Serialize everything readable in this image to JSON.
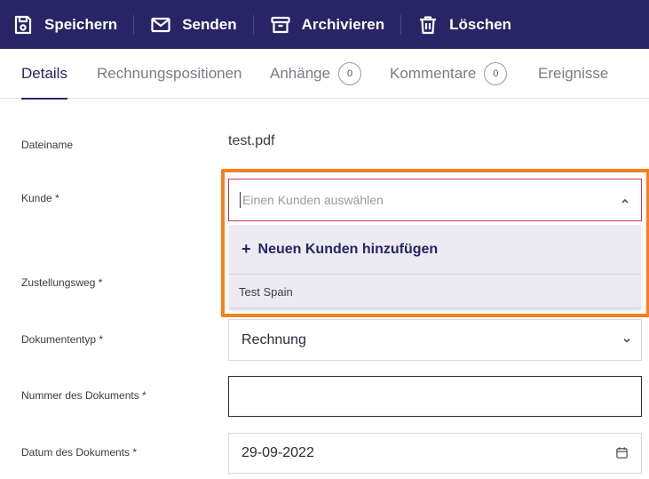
{
  "toolbar": {
    "save_label": "Speichern",
    "send_label": "Senden",
    "archive_label": "Archivieren",
    "delete_label": "Löschen",
    "icons": [
      "save-icon",
      "envelope-icon",
      "archive-icon",
      "trash-icon"
    ]
  },
  "tabs": [
    {
      "label": "Details",
      "active": true
    },
    {
      "label": "Rechnungspositionen"
    },
    {
      "label": "Anhänge",
      "count": "0"
    },
    {
      "label": "Kommentare",
      "count": "0"
    },
    {
      "label": "Ereignisse"
    }
  ],
  "form": {
    "filename_label": "Dateiname",
    "filename_value": "test.pdf",
    "customer_label": "Kunde *",
    "customer_placeholder": "Einen Kunden auswählen",
    "customer_add_label": "Neuen Kunden hinzufügen",
    "customer_options": [
      "Test Spain"
    ],
    "delivery_label": "Zustellungsweg *",
    "doctype_label": "Dokumententyp *",
    "doctype_value": "Rechnung",
    "docnumber_label": "Nummer des Dokuments *",
    "docnumber_value": "",
    "docdate_label": "Datum des Dokuments *",
    "docdate_value": "29-09-2022"
  },
  "colors": {
    "header_bg": "#282566",
    "highlight": "#f77f1f",
    "active_tab": "#282566",
    "invalid_border": "#c9374a"
  }
}
